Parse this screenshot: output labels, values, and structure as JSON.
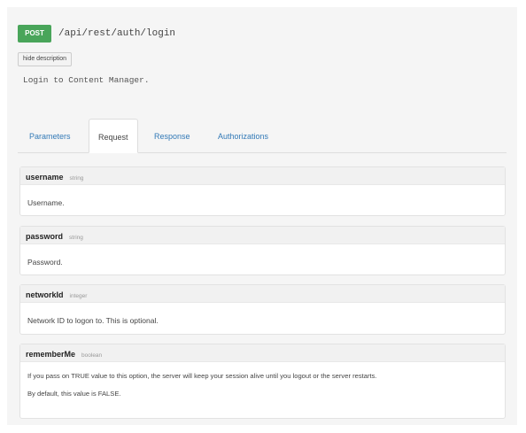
{
  "endpoint": {
    "method": "POST",
    "path": "/api/rest/auth/login",
    "hide_description_label": "hide description",
    "description": "Login to Content Manager."
  },
  "tabs": [
    {
      "label": "Parameters"
    },
    {
      "label": "Request"
    },
    {
      "label": "Response"
    },
    {
      "label": "Authorizations"
    }
  ],
  "active_tab": "Request",
  "fields": [
    {
      "name": "username",
      "type": "string",
      "description": [
        "Username."
      ]
    },
    {
      "name": "password",
      "type": "string",
      "description": [
        "Password."
      ]
    },
    {
      "name": "networkId",
      "type": "integer",
      "description": [
        "Network ID to logon to. This is optional."
      ]
    },
    {
      "name": "rememberMe",
      "type": "boolean",
      "description": [
        "If you pass on TRUE value to this option, the server will keep your session alive until you logout or the server restarts.",
        "By default, this value is FALSE."
      ]
    }
  ],
  "colors": {
    "method_post": "#49a55a",
    "tab_link": "#337ab7"
  }
}
